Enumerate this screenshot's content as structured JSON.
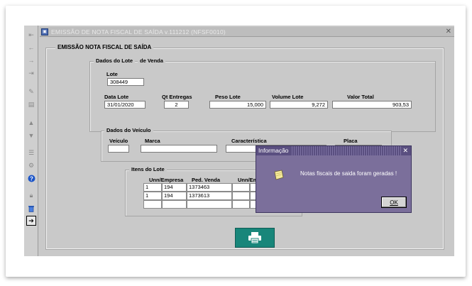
{
  "window": {
    "title": "EMISSÃO DE NOTA FISCAL DE SAÍDA v.111212 (NFSF0010)"
  },
  "panel": {
    "title": "EMISSÃO NOTA FISCAL DE SAÍDA"
  },
  "lote_group": {
    "title_part1": "Dados do Lote",
    "title_part2": "de Venda",
    "lote_label": "Lote",
    "lote_value": "308449",
    "data_lote_label": "Data Lote",
    "data_lote_value": "31/01/2020",
    "qt_entregas_label": "Qt Entregas",
    "qt_entregas_value": "2",
    "peso_lote_label": "Peso Lote",
    "peso_lote_value": "15,000",
    "volume_lote_label": "Volume Lote",
    "volume_lote_value": "9,272",
    "valor_total_label": "Valor Total",
    "valor_total_value": "903,53"
  },
  "veiculo_group": {
    "title": "Dados do Veículo",
    "veiculo_label": "Veículo",
    "marca_label": "Marca",
    "caracteristica_label": "Característica",
    "placa_label": "Placa"
  },
  "itens_group": {
    "title": "Itens do Lote",
    "columns": [
      "Unn/Empresa",
      "Ped. Venda",
      "Unn/Emp"
    ],
    "rows": [
      {
        "unn": "1",
        "empresa": "194",
        "pedido": "1373463"
      },
      {
        "unn": "1",
        "empresa": "194",
        "pedido": "1373613"
      }
    ]
  },
  "dialog": {
    "title": "Informação",
    "message": "Notas fiscais de saida foram geradas !",
    "ok_label": "OK",
    "close_glyph": "✕"
  },
  "icons": {
    "app": "window-icon",
    "print": "printer-icon",
    "info": "note-icon"
  },
  "colors": {
    "print_button": "#18867a",
    "dialog_bg": "#7b6f9b",
    "dialog_title": "#5a4f80"
  }
}
